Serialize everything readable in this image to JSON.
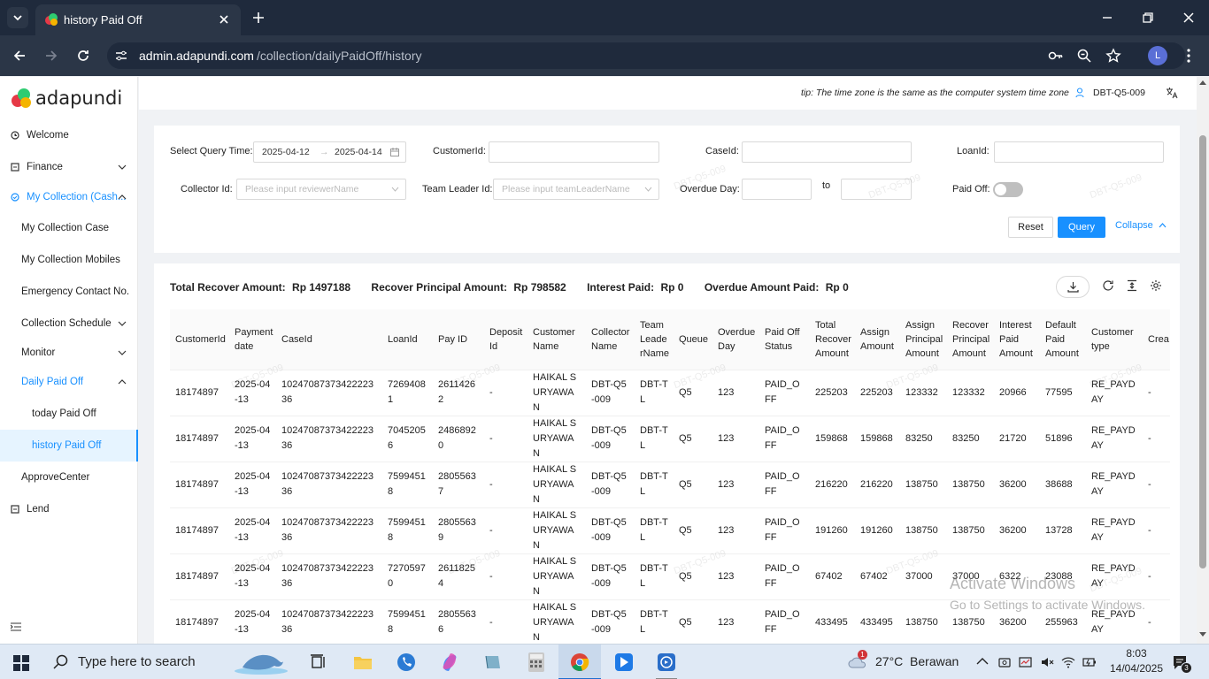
{
  "browser": {
    "tab_title": "history Paid Off",
    "url_host": "admin.adapundi.com",
    "url_path": "/collection/dailyPaidOff/history",
    "profile_initial": "L"
  },
  "brand": {
    "name": "adapundi"
  },
  "sidebar": {
    "items": [
      {
        "label": "Welcome"
      },
      {
        "label": "Finance"
      },
      {
        "label": "My Collection (Cash..."
      },
      {
        "label": "My Collection Case"
      },
      {
        "label": "My Collection Mobiles"
      },
      {
        "label": "Emergency Contact No."
      },
      {
        "label": "Collection Schedule"
      },
      {
        "label": "Monitor"
      },
      {
        "label": "Daily Paid Off"
      },
      {
        "label": "today Paid Off"
      },
      {
        "label": "history Paid Off"
      },
      {
        "label": "ApproveCenter"
      },
      {
        "label": "Lend"
      }
    ]
  },
  "header": {
    "tip": "tip: The time zone is the same as the computer system time zone",
    "user": "DBT-Q5-009"
  },
  "query": {
    "time_label": "Select Query Time:",
    "date_start": "2025-04-12",
    "date_end": "2025-04-14",
    "customer_label": "CustomerId:",
    "case_label": "CaseId:",
    "loan_label": "LoanId:",
    "collector_label": "Collector Id:",
    "collector_placeholder": "Please input reviewerName",
    "leader_label": "Team Leader Id:",
    "leader_placeholder": "Please input teamLeaderName",
    "overdue_label": "Overdue Day:",
    "to_label": "to",
    "paidoff_label": "Paid Off:",
    "reset": "Reset",
    "query": "Query",
    "collapse": "Collapse"
  },
  "summary": {
    "recover_label": "Total Recover Amount:",
    "recover_value": "Rp 1497188",
    "principal_label": "Recover Principal Amount:",
    "principal_value": "Rp 798582",
    "interest_label": "Interest Paid:",
    "interest_value": "Rp 0",
    "overdue_label": "Overdue Amount Paid:",
    "overdue_value": "Rp 0"
  },
  "table": {
    "columns": [
      "CustomerId",
      "Payment date",
      "CaseId",
      "LoanId",
      "Pay ID",
      "Deposit Id",
      "Customer Name",
      "Collector Name",
      "Team Leade rName",
      "Queue",
      "Overdue Day",
      "Paid Off Status",
      "Total Recover Amount",
      "Assign Amount",
      "Assign Principal Amount",
      "Recover Principal Amount",
      "Interest Paid Amount",
      "Default Paid Amount",
      "Customer type",
      "Crea"
    ],
    "rows": [
      [
        "18174897",
        "2025-04-13",
        "1024708737342222336",
        "72694081",
        "26114262",
        "-",
        "HAIKAL SURYAWAN",
        "DBT-Q5-009",
        "DBT-TL",
        "Q5",
        "123",
        "PAID_OFF",
        "225203",
        "225203",
        "123332",
        "123332",
        "20966",
        "77595",
        "RE_PAYDAY",
        "-"
      ],
      [
        "18174897",
        "2025-04-13",
        "1024708737342222336",
        "70452056",
        "24868920",
        "-",
        "HAIKAL SURYAWAN",
        "DBT-Q5-009",
        "DBT-TL",
        "Q5",
        "123",
        "PAID_OFF",
        "159868",
        "159868",
        "83250",
        "83250",
        "21720",
        "51896",
        "RE_PAYDAY",
        "-"
      ],
      [
        "18174897",
        "2025-04-13",
        "1024708737342222336",
        "75994518",
        "28055637",
        "-",
        "HAIKAL SURYAWAN",
        "DBT-Q5-009",
        "DBT-TL",
        "Q5",
        "123",
        "PAID_OFF",
        "216220",
        "216220",
        "138750",
        "138750",
        "36200",
        "38688",
        "RE_PAYDAY",
        "-"
      ],
      [
        "18174897",
        "2025-04-13",
        "1024708737342222336",
        "75994518",
        "28055639",
        "-",
        "HAIKAL SURYAWAN",
        "DBT-Q5-009",
        "DBT-TL",
        "Q5",
        "123",
        "PAID_OFF",
        "191260",
        "191260",
        "138750",
        "138750",
        "36200",
        "13728",
        "RE_PAYDAY",
        "-"
      ],
      [
        "18174897",
        "2025-04-13",
        "1024708737342222336",
        "72705970",
        "26118254",
        "-",
        "HAIKAL SURYAWAN",
        "DBT-Q5-009",
        "DBT-TL",
        "Q5",
        "123",
        "PAID_OFF",
        "67402",
        "67402",
        "37000",
        "37000",
        "6322",
        "23088",
        "RE_PAYDAY",
        "-"
      ],
      [
        "18174897",
        "2025-04-13",
        "1024708737342222336",
        "75994518",
        "28055636",
        "-",
        "HAIKAL SURYAWAN",
        "DBT-Q5-009",
        "DBT-TL",
        "Q5",
        "123",
        "PAID_OFF",
        "433495",
        "433495",
        "138750",
        "138750",
        "36200",
        "255963",
        "RE_PAYDAY",
        "-"
      ]
    ]
  },
  "watermark": "DBT-Q5-009",
  "activation": {
    "title": "Activate Windows",
    "subtitle": "Go to Settings to activate Windows."
  },
  "taskbar": {
    "search_placeholder": "Type here to search",
    "weather": "27°C  Berawan",
    "time": "8:03",
    "date": "14/04/2025",
    "notification_count": "3",
    "weather_badge": "1"
  }
}
